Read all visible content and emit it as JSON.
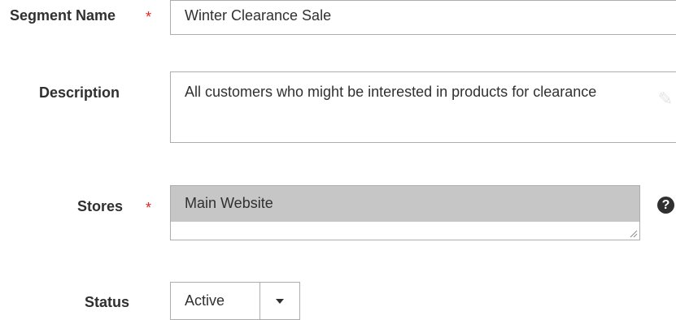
{
  "form": {
    "segment_name": {
      "label": "Segment Name",
      "required_marker": "*",
      "value": "Winter Clearance Sale"
    },
    "description": {
      "label": "Description",
      "value": "All customers who might be interested in products for clearance"
    },
    "stores": {
      "label": "Stores",
      "required_marker": "*",
      "selected_value": "Main Website",
      "help_icon_glyph": "?"
    },
    "status": {
      "label": "Status",
      "selected_value": "Active"
    }
  },
  "colors": {
    "required": "#e22626",
    "selected_option_bg": "#c6c6c6",
    "border": "#adadad"
  },
  "icons": [
    "help-icon",
    "chevron-down-icon",
    "resize-grip-icon"
  ]
}
